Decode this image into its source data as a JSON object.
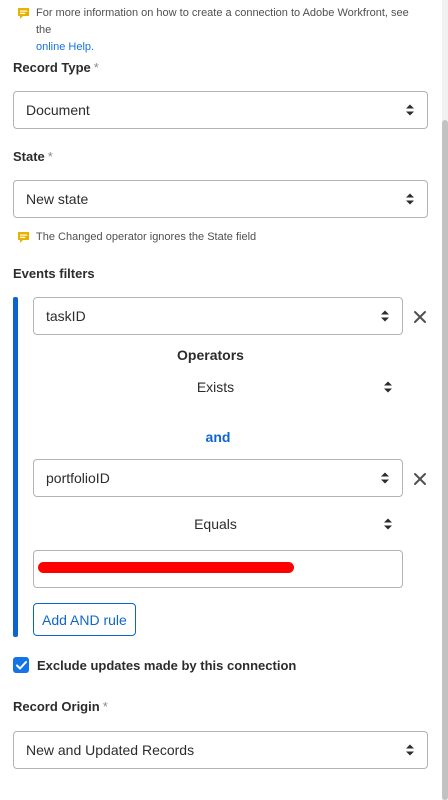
{
  "info_note": {
    "text": "For more information on how to create a connection to Adobe Workfront, see the",
    "link": "online Help."
  },
  "record_type": {
    "label": "Record Type",
    "required_mark": "*",
    "value": "Document"
  },
  "state": {
    "label": "State",
    "required_mark": "*",
    "value": "New state"
  },
  "state_note": {
    "text": "The Changed operator ignores the State field"
  },
  "events_filters": {
    "label": "Events filters",
    "rules": [
      {
        "field": "taskID",
        "operator": "Exists"
      },
      {
        "field": "portfolioID",
        "operator": "Equals",
        "value": ""
      }
    ],
    "operators_title": "Operators",
    "conjunction": "and",
    "add_rule_label": "Add AND rule"
  },
  "exclude_updates": {
    "label": "Exclude updates made by this connection",
    "checked": true
  },
  "record_origin": {
    "label": "Record Origin",
    "required_mark": "*",
    "value": "New and Updated Records"
  },
  "colors": {
    "accent": "#0d66d0",
    "note_icon": "#e8b200",
    "redaction": "#ff0000"
  },
  "icons": {
    "note": "comment-note-icon",
    "updown": "chevron-updown-icon",
    "remove": "close-icon",
    "check": "checkmark-icon"
  }
}
